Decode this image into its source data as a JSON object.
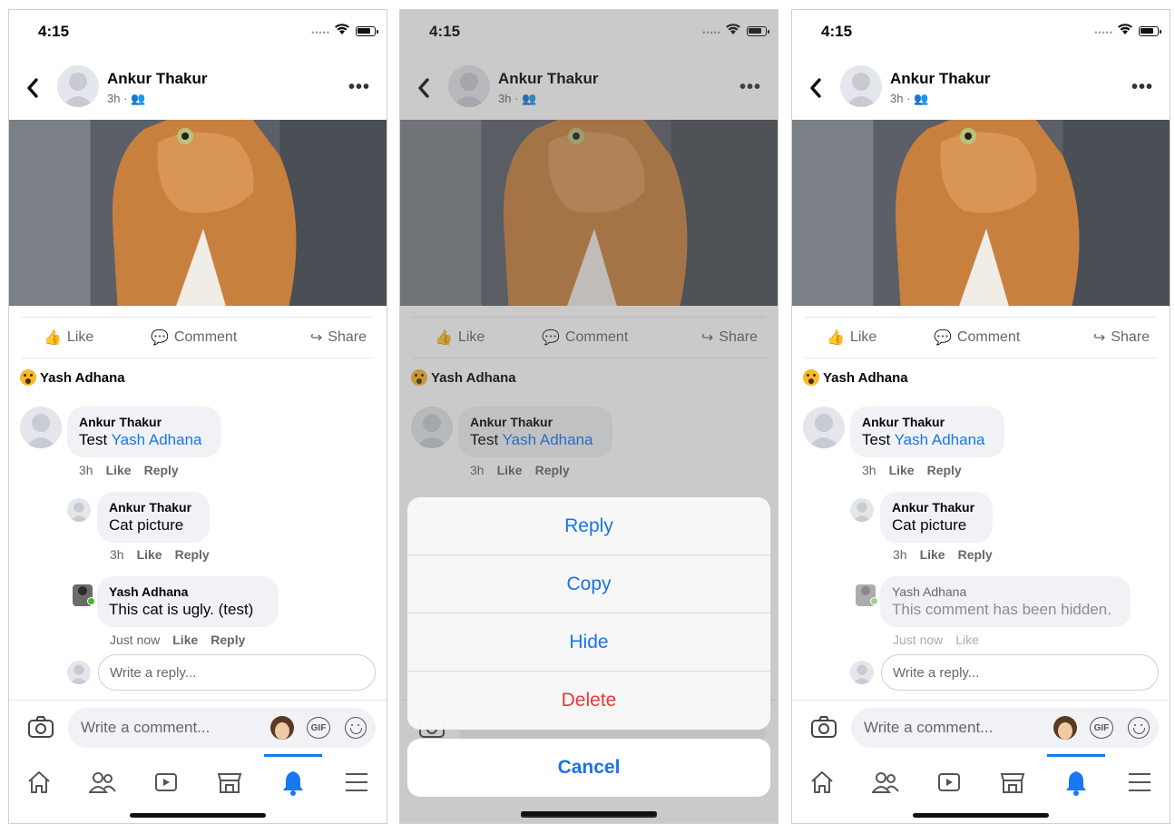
{
  "status": {
    "time": "4:15"
  },
  "post": {
    "author": "Ankur Thakur",
    "meta": "3h ·",
    "actions": {
      "like": "Like",
      "comment": "Comment",
      "share": "Share"
    },
    "reactor": "Yash Adhana"
  },
  "comments": [
    {
      "author": "Ankur Thakur",
      "text_prefix": "Test ",
      "mention": "Yash Adhana",
      "time": "3h",
      "like": "Like",
      "reply": "Reply"
    },
    {
      "author": "Ankur Thakur",
      "text": "Cat picture",
      "time": "3h",
      "like": "Like",
      "reply": "Reply"
    },
    {
      "author": "Yash Adhana",
      "text": "This cat is ugly. (test)",
      "time": "Just now",
      "like": "Like",
      "reply": "Reply"
    }
  ],
  "hidden_comment": {
    "author": "Yash Adhana",
    "text": "This comment has been hidden.",
    "time": "Just now",
    "like": "Like"
  },
  "reply_placeholder": "Write a reply...",
  "composer": {
    "placeholder": "Write a comment...",
    "gif": "GIF"
  },
  "action_sheet": {
    "items": [
      "Reply",
      "Copy",
      "Hide",
      "Delete"
    ],
    "cancel": "Cancel"
  },
  "colors": {
    "accent": "#1877f2",
    "destructive": "#e8393b",
    "ios_blue": "#1a73e8"
  }
}
